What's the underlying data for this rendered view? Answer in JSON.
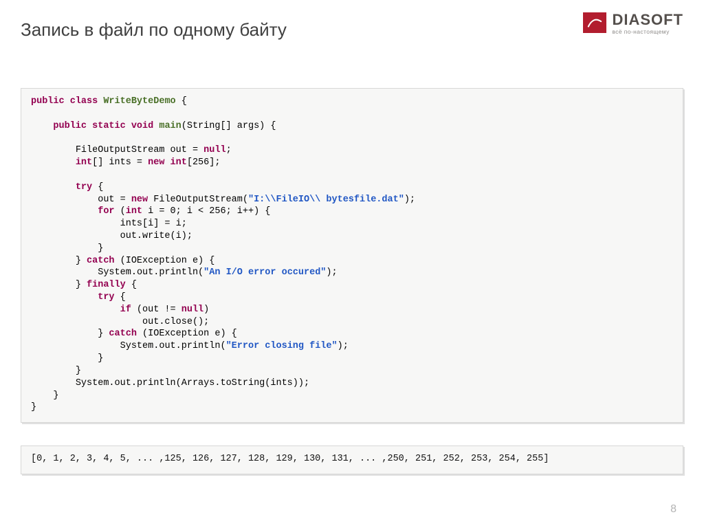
{
  "title": "Запись в файл по одному байту",
  "logo": {
    "brand": "DIASOFT",
    "tagline": "всё по-настоящему"
  },
  "page_number": "8",
  "output": "[0, 1, 2, 3, 4, 5, ... ,125, 126, 127, 128, 129, 130, 131, ... ,250, 251, 252, 253, 254, 255]",
  "code": [
    {
      "i": 0,
      "t": [
        {
          "c": "kw",
          "v": "public class"
        },
        {
          "c": "plain",
          "v": " "
        },
        {
          "c": "cls",
          "v": "WriteByteDemo"
        },
        {
          "c": "plain",
          "v": " {"
        }
      ]
    },
    {
      "i": 0,
      "t": [
        {
          "c": "plain",
          "v": ""
        }
      ]
    },
    {
      "i": 1,
      "t": [
        {
          "c": "kw",
          "v": "public static void"
        },
        {
          "c": "plain",
          "v": " "
        },
        {
          "c": "cls",
          "v": "main"
        },
        {
          "c": "plain",
          "v": "(String[] args) {"
        }
      ]
    },
    {
      "i": 0,
      "t": [
        {
          "c": "plain",
          "v": ""
        }
      ]
    },
    {
      "i": 2,
      "t": [
        {
          "c": "plain",
          "v": "FileOutputStream out = "
        },
        {
          "c": "kw",
          "v": "null"
        },
        {
          "c": "plain",
          "v": ";"
        }
      ]
    },
    {
      "i": 2,
      "t": [
        {
          "c": "kw",
          "v": "int"
        },
        {
          "c": "plain",
          "v": "[] ints = "
        },
        {
          "c": "kw",
          "v": "new int"
        },
        {
          "c": "plain",
          "v": "[256];"
        }
      ]
    },
    {
      "i": 0,
      "t": [
        {
          "c": "plain",
          "v": ""
        }
      ]
    },
    {
      "i": 2,
      "t": [
        {
          "c": "kw",
          "v": "try"
        },
        {
          "c": "plain",
          "v": " {"
        }
      ]
    },
    {
      "i": 3,
      "t": [
        {
          "c": "plain",
          "v": "out = "
        },
        {
          "c": "kw",
          "v": "new"
        },
        {
          "c": "plain",
          "v": " FileOutputStream("
        },
        {
          "c": "str",
          "v": "\"I:\\\\FileIO\\\\ bytesfile.dat\""
        },
        {
          "c": "plain",
          "v": ");"
        }
      ]
    },
    {
      "i": 3,
      "t": [
        {
          "c": "kw",
          "v": "for"
        },
        {
          "c": "plain",
          "v": " ("
        },
        {
          "c": "kw",
          "v": "int"
        },
        {
          "c": "plain",
          "v": " i = 0; i < 256; i++) {"
        }
      ]
    },
    {
      "i": 4,
      "t": [
        {
          "c": "plain",
          "v": "ints[i] = i;"
        }
      ]
    },
    {
      "i": 4,
      "t": [
        {
          "c": "plain",
          "v": "out.write(i);"
        }
      ]
    },
    {
      "i": 3,
      "t": [
        {
          "c": "plain",
          "v": "}"
        }
      ]
    },
    {
      "i": 2,
      "t": [
        {
          "c": "plain",
          "v": "} "
        },
        {
          "c": "kw",
          "v": "catch"
        },
        {
          "c": "plain",
          "v": " (IOException e) {"
        }
      ]
    },
    {
      "i": 3,
      "t": [
        {
          "c": "plain",
          "v": "System."
        },
        {
          "c": "field",
          "v": "out"
        },
        {
          "c": "plain",
          "v": ".println("
        },
        {
          "c": "str",
          "v": "\"An I/O error occured\""
        },
        {
          "c": "plain",
          "v": ");"
        }
      ]
    },
    {
      "i": 2,
      "t": [
        {
          "c": "plain",
          "v": "} "
        },
        {
          "c": "kw",
          "v": "finally"
        },
        {
          "c": "plain",
          "v": " {"
        }
      ]
    },
    {
      "i": 3,
      "t": [
        {
          "c": "kw",
          "v": "try"
        },
        {
          "c": "plain",
          "v": " {"
        }
      ]
    },
    {
      "i": 4,
      "t": [
        {
          "c": "kw",
          "v": "if"
        },
        {
          "c": "plain",
          "v": " (out != "
        },
        {
          "c": "kw",
          "v": "null"
        },
        {
          "c": "plain",
          "v": ")"
        }
      ]
    },
    {
      "i": 5,
      "t": [
        {
          "c": "plain",
          "v": "out.close();"
        }
      ]
    },
    {
      "i": 3,
      "t": [
        {
          "c": "plain",
          "v": "} "
        },
        {
          "c": "kw",
          "v": "catch"
        },
        {
          "c": "plain",
          "v": " (IOException e) {"
        }
      ]
    },
    {
      "i": 4,
      "t": [
        {
          "c": "plain",
          "v": "System."
        },
        {
          "c": "field",
          "v": "out"
        },
        {
          "c": "plain",
          "v": ".println("
        },
        {
          "c": "str",
          "v": "\"Error closing file\""
        },
        {
          "c": "plain",
          "v": ");"
        }
      ]
    },
    {
      "i": 3,
      "t": [
        {
          "c": "plain",
          "v": "}"
        }
      ]
    },
    {
      "i": 2,
      "t": [
        {
          "c": "plain",
          "v": "}"
        }
      ]
    },
    {
      "i": 2,
      "t": [
        {
          "c": "plain",
          "v": "System."
        },
        {
          "c": "field",
          "v": "out"
        },
        {
          "c": "plain",
          "v": ".println(Arrays."
        },
        {
          "c": "plain",
          "v": "toString"
        },
        {
          "c": "plain",
          "v": "(ints));"
        }
      ]
    },
    {
      "i": 1,
      "t": [
        {
          "c": "plain",
          "v": "}"
        }
      ]
    },
    {
      "i": 0,
      "t": [
        {
          "c": "plain",
          "v": "}"
        }
      ]
    }
  ]
}
